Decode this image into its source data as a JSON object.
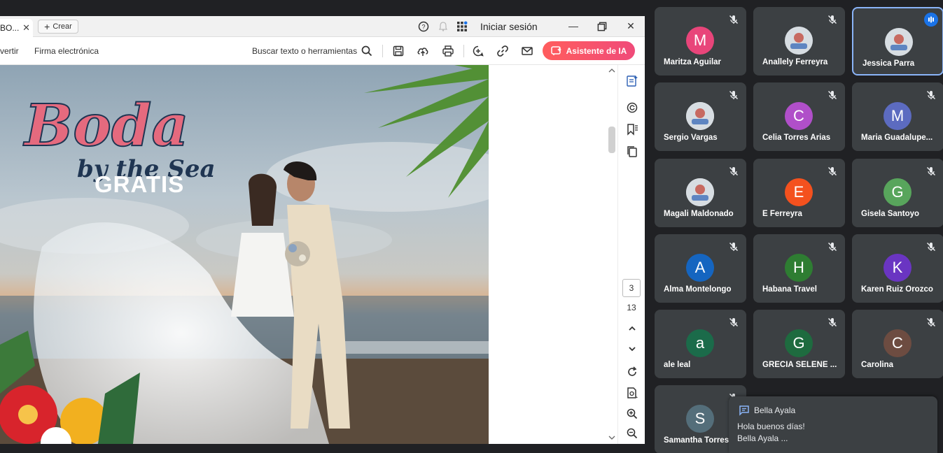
{
  "acrobat": {
    "tab_title": "BO...",
    "new_tab_label": "Crear",
    "signin_label": "Iniciar sesión",
    "toolbar": {
      "convert_label": "vertir",
      "esign_label": "Firma electrónica",
      "search_label": "Buscar texto o herramientas",
      "ai_assistant_label": "Asistente de IA"
    },
    "document": {
      "title_script": "Boda",
      "subtitle_script": "by the Sea",
      "badge": "GRATIS"
    },
    "page_nav": {
      "current_page": "3",
      "total_pages": "13"
    },
    "accent_color": "#f04b5f"
  },
  "meet": {
    "participants": [
      {
        "name": "Maritza Aguilar",
        "initial": "M",
        "color": "#e8457a",
        "avatar_type": "initial"
      },
      {
        "name": "Anallely Ferreyra",
        "initial": "",
        "color": "#5f6368",
        "avatar_type": "photo"
      },
      {
        "name": "Jessica Parra",
        "initial": "",
        "color": "#5f6368",
        "avatar_type": "photo",
        "speaking": true
      },
      {
        "name": "Sergio Vargas",
        "initial": "",
        "color": "#ffffff",
        "avatar_type": "photo"
      },
      {
        "name": "Celia Torres Arias",
        "initial": "C",
        "color": "#b04fc9",
        "avatar_type": "initial"
      },
      {
        "name": "Maria Guadalupe...",
        "initial": "M",
        "color": "#5c6bc0",
        "avatar_type": "initial"
      },
      {
        "name": "Magali Maldonado",
        "initial": "",
        "color": "#ffffff",
        "avatar_type": "photo"
      },
      {
        "name": "E Ferreyra",
        "initial": "E",
        "color": "#f4511e",
        "avatar_type": "initial"
      },
      {
        "name": "Gisela Santoyo",
        "initial": "G",
        "color": "#58a55c",
        "avatar_type": "initial"
      },
      {
        "name": "Alma Montelongo",
        "initial": "A",
        "color": "#1565c0",
        "avatar_type": "initial"
      },
      {
        "name": "Habana Travel",
        "initial": "H",
        "color": "#2e7d32",
        "avatar_type": "initial"
      },
      {
        "name": "Karen Ruiz Orozco",
        "initial": "K",
        "color": "#6a35c2",
        "avatar_type": "initial"
      },
      {
        "name": "ale leal",
        "initial": "a",
        "color": "#1b6b4a",
        "avatar_type": "initial"
      },
      {
        "name": "GRECIA SELENE ...",
        "initial": "G",
        "color": "#1e6b3f",
        "avatar_type": "initial"
      },
      {
        "name": "Carolina",
        "initial": "C",
        "color": "#6d4c41",
        "avatar_type": "initial"
      },
      {
        "name": "Samantha Torres",
        "initial": "S",
        "color": "#546e7a",
        "avatar_type": "initial"
      }
    ],
    "chat": {
      "sender": "Bella Ayala",
      "message": "Hola buenos días!",
      "preview": "Bella Ayala ..."
    }
  }
}
